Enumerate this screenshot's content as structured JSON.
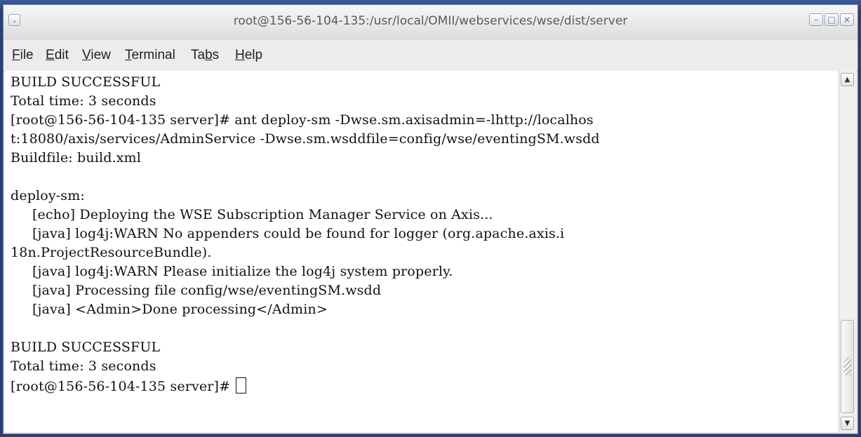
{
  "window": {
    "title": "root@156-56-104-135:/usr/local/OMII/webservices/wse/dist/server",
    "icons": {
      "menu": "chevron-down-icon",
      "minimize": "minimize-icon",
      "maximize": "maximize-icon",
      "close": "close-icon"
    }
  },
  "menubar": {
    "items": [
      {
        "label": "File",
        "mnemonic": "F"
      },
      {
        "label": "Edit",
        "mnemonic": "E"
      },
      {
        "label": "View",
        "mnemonic": "V"
      },
      {
        "label": "Terminal",
        "mnemonic": "T"
      },
      {
        "label": "Tabs",
        "mnemonic": "b"
      },
      {
        "label": "Help",
        "mnemonic": "H"
      }
    ]
  },
  "terminal": {
    "lines": [
      "BUILD SUCCESSFUL",
      "Total time: 3 seconds",
      "[root@156-56-104-135 server]# ant deploy-sm -Dwse.sm.axisadmin=-lhttp://localhos",
      "t:18080/axis/services/AdminService -Dwse.sm.wsddfile=config/wse/eventingSM.wsdd",
      "Buildfile: build.xml",
      "",
      "deploy-sm:",
      "     [echo] Deploying the WSE Subscription Manager Service on Axis...",
      "     [java] log4j:WARN No appenders could be found for logger (org.apache.axis.i",
      "18n.ProjectResourceBundle).",
      "     [java] log4j:WARN Please initialize the log4j system properly.",
      "     [java] Processing file config/wse/eventingSM.wsdd",
      "     [java] <Admin>Done processing</Admin>",
      "",
      "BUILD SUCCESSFUL",
      "Total time: 3 seconds"
    ],
    "prompt": "[root@156-56-104-135 server]# "
  },
  "colors": {
    "terminal_bg": "#ffffff",
    "terminal_fg": "#111111",
    "titlebar": "#e6e6e6",
    "desktop": "#2a3f72"
  }
}
